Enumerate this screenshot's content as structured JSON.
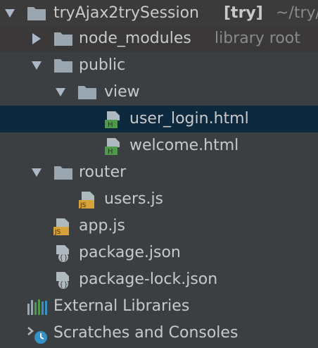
{
  "project": {
    "name": "tryAjax2trySession",
    "module_tag": "[try]",
    "path": "~/try/"
  },
  "tree": {
    "node_modules": {
      "label": "node_modules",
      "hint": "library root"
    },
    "public": {
      "label": "public"
    },
    "view": {
      "label": "view"
    },
    "user_login": {
      "label": "user_login.html"
    },
    "welcome": {
      "label": "welcome.html"
    },
    "router": {
      "label": "router"
    },
    "users_js": {
      "label": "users.js"
    },
    "app_js": {
      "label": "app.js"
    },
    "package_json": {
      "label": "package.json"
    },
    "package_lock": {
      "label": "package-lock.json"
    }
  },
  "external_libraries": {
    "label": "External Libraries"
  },
  "scratches": {
    "label": "Scratches and Consoles"
  },
  "colors": {
    "background": "#3c3f41",
    "selected_row": "#0d293e",
    "folder": "#9aa7b0",
    "js_badge": "#d6a23a",
    "html_badge": "#4f9a4a"
  }
}
